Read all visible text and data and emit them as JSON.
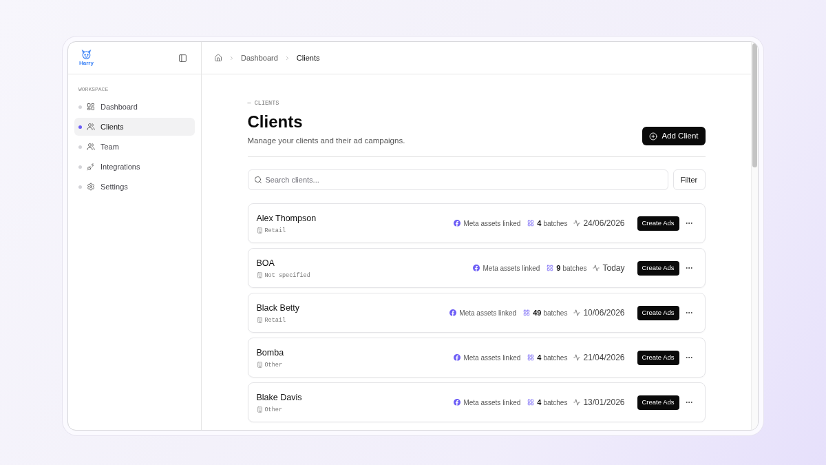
{
  "sidebar": {
    "logo": "Harry",
    "section_label": "WORKSPACE",
    "items": [
      {
        "label": "Dashboard",
        "selected": false
      },
      {
        "label": "Clients",
        "selected": true
      },
      {
        "label": "Team",
        "selected": false
      },
      {
        "label": "Integrations",
        "selected": false
      },
      {
        "label": "Settings",
        "selected": false
      }
    ]
  },
  "breadcrumb": [
    {
      "label": "Dashboard",
      "current": false
    },
    {
      "label": "Clients",
      "current": true
    }
  ],
  "page": {
    "eyebrow": "— CLIENTS",
    "title": "Clients",
    "subtitle": "Manage your clients and their ad campaigns.",
    "add_button": "Add Client"
  },
  "search": {
    "placeholder": "Search clients..."
  },
  "filter_button": "Filter",
  "clients": [
    {
      "name": "Alex Thompson",
      "category": "Retail",
      "meta_status": "Meta assets linked",
      "batch_count": "4",
      "batch_label": "batches",
      "last_activity": "24/06/2026",
      "action": "Create Ads"
    },
    {
      "name": "BOA",
      "category": "Not specified",
      "meta_status": "Meta assets linked",
      "batch_count": "9",
      "batch_label": "batches",
      "last_activity": "Today",
      "action": "Create Ads"
    },
    {
      "name": "Black Betty",
      "category": "Retail",
      "meta_status": "Meta assets linked",
      "batch_count": "49",
      "batch_label": "batches",
      "last_activity": "10/06/2026",
      "action": "Create Ads"
    },
    {
      "name": "Bomba",
      "category": "Other",
      "meta_status": "Meta assets linked",
      "batch_count": "4",
      "batch_label": "batches",
      "last_activity": "21/04/2026",
      "action": "Create Ads"
    },
    {
      "name": "Blake Davis",
      "category": "Other",
      "meta_status": "Meta assets linked",
      "batch_count": "4",
      "batch_label": "batches",
      "last_activity": "13/01/2026",
      "action": "Create Ads"
    }
  ]
}
